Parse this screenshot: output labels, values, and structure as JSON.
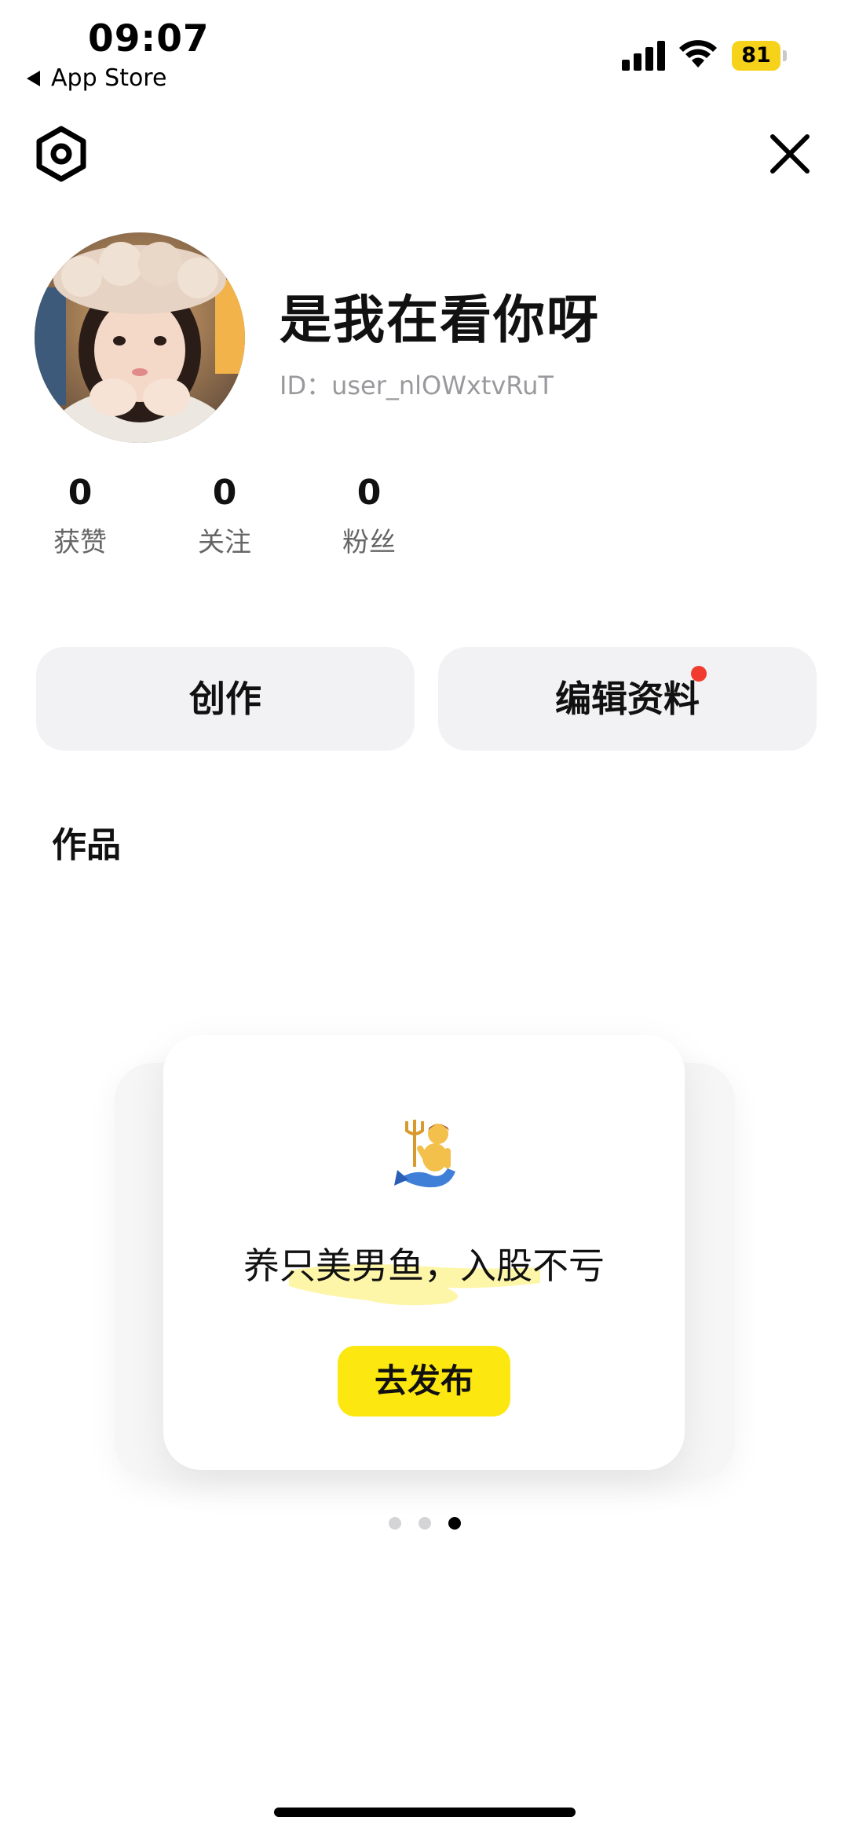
{
  "status_bar": {
    "time": "09:07",
    "back_label": "App Store",
    "battery": "81",
    "battery_color": "#f7d21b"
  },
  "header": {
    "settings_icon": "settings-gear-icon",
    "close_icon": "close-icon"
  },
  "profile": {
    "nickname": "是我在看你呀",
    "id_text": "ID：user_nlOWxtvRuT"
  },
  "stats": [
    {
      "value": "0",
      "label": "获赞"
    },
    {
      "value": "0",
      "label": "关注"
    },
    {
      "value": "0",
      "label": "粉丝"
    }
  ],
  "actions": {
    "create_label": "创作",
    "edit_label": "编辑资料",
    "badge_color": "#f03b2e"
  },
  "works": {
    "title": "作品",
    "card": {
      "emoji_icon": "merman-icon",
      "slogan": "养只美男鱼，入股不亏",
      "button_label": "去发布",
      "button_color": "#fde710"
    },
    "pager": {
      "count": 3,
      "active_index": 2
    }
  }
}
